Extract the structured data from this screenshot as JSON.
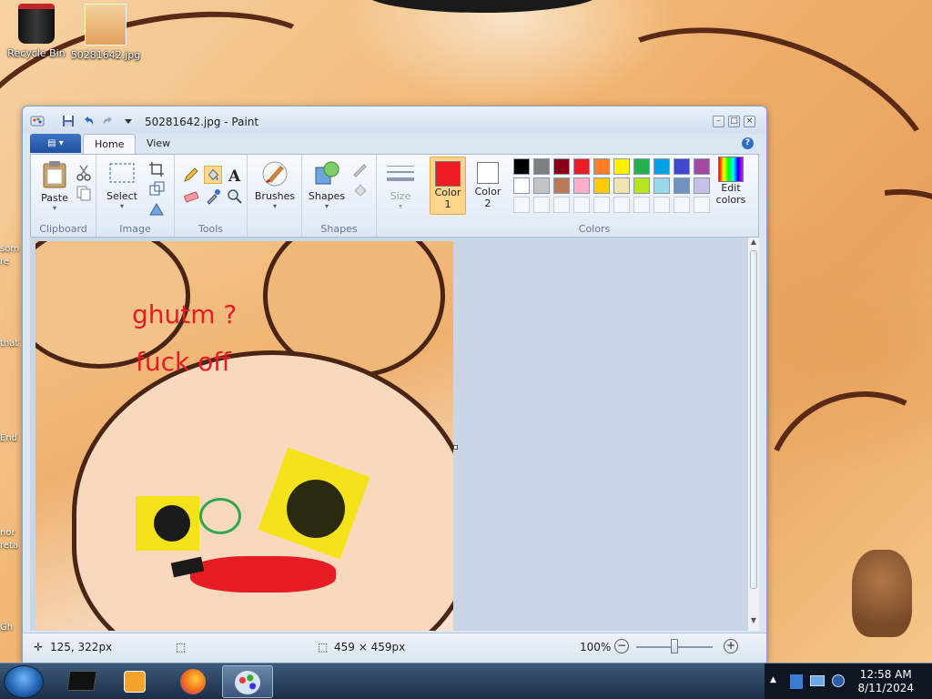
{
  "desktop": {
    "icons": [
      {
        "label": "Recycle Bin"
      },
      {
        "label": "50281642.jpg"
      }
    ],
    "edge_labels": [
      "som",
      "re",
      "that",
      "End",
      "nor",
      "reta",
      "Gh"
    ]
  },
  "window": {
    "title": "50281642.jpg - Paint",
    "tabs": [
      "Home",
      "View"
    ],
    "ribbon": {
      "clipboard": {
        "paste": "Paste",
        "group": "Clipboard"
      },
      "image": {
        "select": "Select",
        "group": "Image"
      },
      "tools": {
        "group": "Tools"
      },
      "brushes": {
        "label": "Brushes"
      },
      "shapes": {
        "label": "Shapes",
        "group": "Shapes"
      },
      "size": {
        "label": "Size"
      },
      "color1": {
        "label": "Color\n1",
        "value": "#ed1c24"
      },
      "color2": {
        "label": "Color\n2",
        "value": "#ffffff"
      },
      "colors_group": "Colors",
      "edit_colors": "Edit\ncolors",
      "palette_row1": [
        "#000000",
        "#7f7f7f",
        "#880015",
        "#ed1c24",
        "#ff7f27",
        "#fff200",
        "#22b14c",
        "#00a2e8",
        "#3f48cc",
        "#a349a4"
      ],
      "palette_row2": [
        "#ffffff",
        "#c3c3c3",
        "#b97a57",
        "#ffaec9",
        "#ffc90e",
        "#efe4b0",
        "#b5e61d",
        "#99d9ea",
        "#7092be",
        "#c8bfe7"
      ]
    },
    "canvas_text": [
      "ghutm ?",
      "fuck off"
    ],
    "status": {
      "cursor": "125, 322px",
      "image_size": "459 × 459px",
      "zoom": "100%"
    }
  },
  "taskbar": {
    "time": "12:58 AM",
    "date": "8/11/2024"
  }
}
